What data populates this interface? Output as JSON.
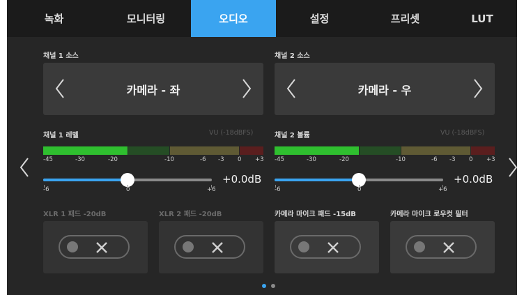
{
  "tabs": [
    {
      "label": "녹화",
      "active": false
    },
    {
      "label": "모니터링",
      "active": false
    },
    {
      "label": "오디오",
      "active": true
    },
    {
      "label": "설정",
      "active": false
    },
    {
      "label": "프리셋",
      "active": false
    },
    {
      "label": "LUT",
      "active": false
    }
  ],
  "channel1": {
    "source_label": "채널 1 소스",
    "source_value": "카메라 - 좌",
    "level_label": "채널 1 레벨",
    "vu_label": "VU (-18dBFS)",
    "db_value": "+0.0dB",
    "slider_fraction": 0.5
  },
  "channel2": {
    "source_label": "채널 2 소스",
    "source_value": "카메라 - 우",
    "level_label": "채널 2 볼륨",
    "vu_label": "VU (-18dBFS)",
    "db_value": "+0.0dB",
    "slider_fraction": 0.5
  },
  "meter_scale": [
    "-45",
    "-30",
    "-20",
    "-10",
    "-6",
    "-3",
    "0",
    "+3"
  ],
  "slider_scale": [
    "-6",
    "0",
    "+6"
  ],
  "toggles": [
    {
      "label": "XLR 1 패드 -20dB",
      "enabled_label": false,
      "state": "off"
    },
    {
      "label": "XLR 2 패드 -20dB",
      "enabled_label": false,
      "state": "off"
    },
    {
      "label": "카메라 마이크 패드 -15dB",
      "enabled_label": true,
      "state": "off"
    },
    {
      "label": "카메라 마이크 로우컷 필터",
      "enabled_label": true,
      "state": "off"
    }
  ],
  "pagination": {
    "current": 1,
    "total": 2
  },
  "colors": {
    "accent": "#3aa4f0",
    "meter_green": "#2fbf2f",
    "meter_dark_green": "#254d25",
    "meter_olive": "#5f5a34",
    "meter_red": "#5a1e1e"
  }
}
